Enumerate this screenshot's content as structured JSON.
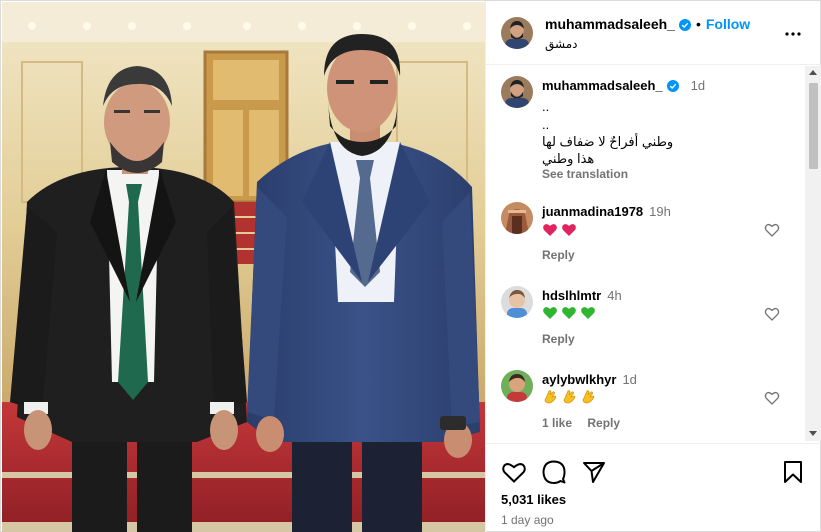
{
  "post": {
    "username": "muhammadsaleeh_",
    "follow_label": "Follow",
    "separator": "•",
    "location": "دمشق",
    "likes": "5,031 likes",
    "time_ago": "1 day ago"
  },
  "caption": {
    "username": "muhammadsaleeh_",
    "time": "1d",
    "line1": "..",
    "line2": "..",
    "line3": "وطني أفراحٌ لا ضفاف لها",
    "line4": "هذا وطني",
    "see_translation": "See translation"
  },
  "comments": [
    {
      "username": "juanmadina1978",
      "time": "19h",
      "emoji": [
        "red-heart",
        "red-heart"
      ],
      "reply_label": "Reply",
      "likes_label": ""
    },
    {
      "username": "hdslhlmtr",
      "time": "4h",
      "emoji": [
        "green-heart",
        "green-heart",
        "green-heart"
      ],
      "reply_label": "Reply",
      "likes_label": ""
    },
    {
      "username": "aylybwlkhyr",
      "time": "1d",
      "emoji": [
        "clap",
        "clap",
        "clap"
      ],
      "reply_label": "Reply",
      "likes_label": "1 like"
    }
  ],
  "icons": [
    "verified-badge-icon",
    "more-options-icon",
    "heart-icon",
    "comment-icon",
    "share-icon",
    "bookmark-icon"
  ],
  "colors": {
    "link_blue": "#0095f6",
    "muted": "#737373",
    "border": "#dbdbdb",
    "red_heart": "#e0245e",
    "green_heart": "#2fb52f"
  }
}
